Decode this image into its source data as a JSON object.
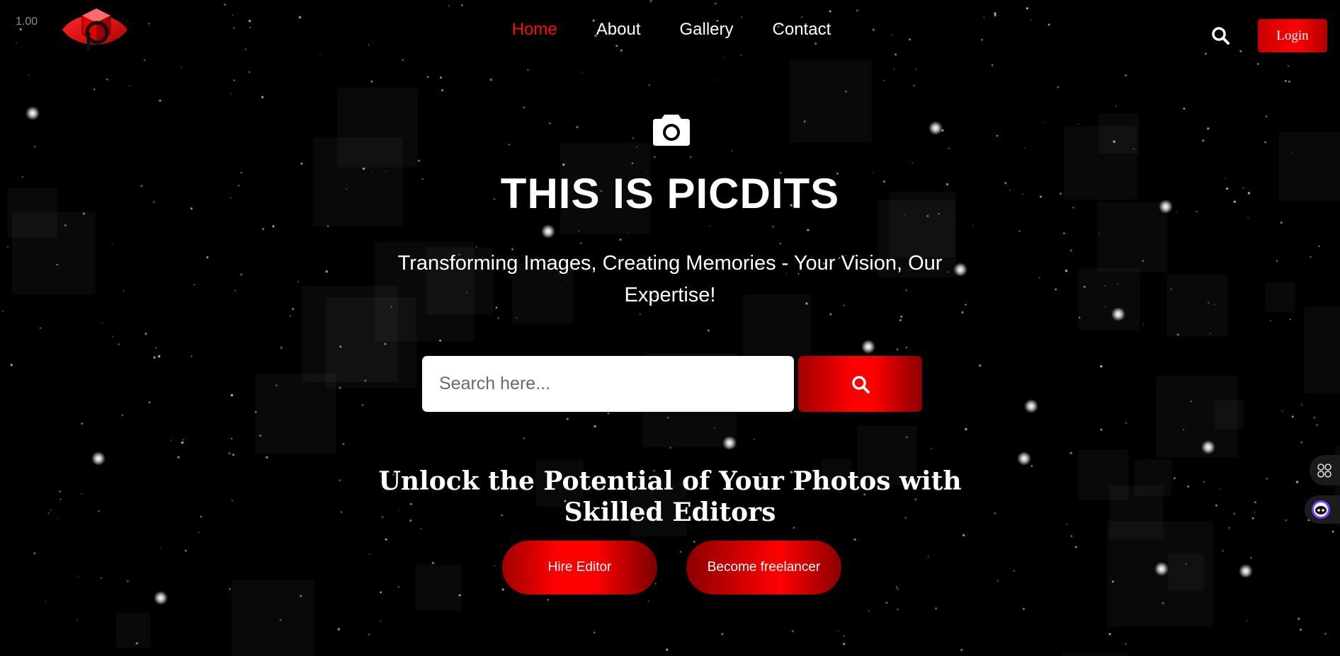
{
  "version_label": "1.00",
  "brand": {
    "logo_letter": "P",
    "accent_color": "#ff0000"
  },
  "nav": {
    "items": [
      {
        "label": "Home",
        "active": true
      },
      {
        "label": "About",
        "active": false
      },
      {
        "label": "Gallery",
        "active": false
      },
      {
        "label": "Contact",
        "active": false
      }
    ],
    "search_icon": "search-icon",
    "login_label": "Login"
  },
  "hero": {
    "icon": "camera-icon",
    "title": "THIS IS PICDITS",
    "subtitle": "Transforming Images, Creating Memories - Your Vision, Our Expertise!",
    "search": {
      "placeholder": "Search here...",
      "button_icon": "search-icon"
    },
    "tagline": "Unlock the Potential of Your Photos with Skilled Editors",
    "buttons": {
      "hire": "Hire Editor",
      "freelance": "Become freelancer"
    }
  },
  "side_widgets": [
    "grid-icon",
    "assistant-bot-icon"
  ]
}
